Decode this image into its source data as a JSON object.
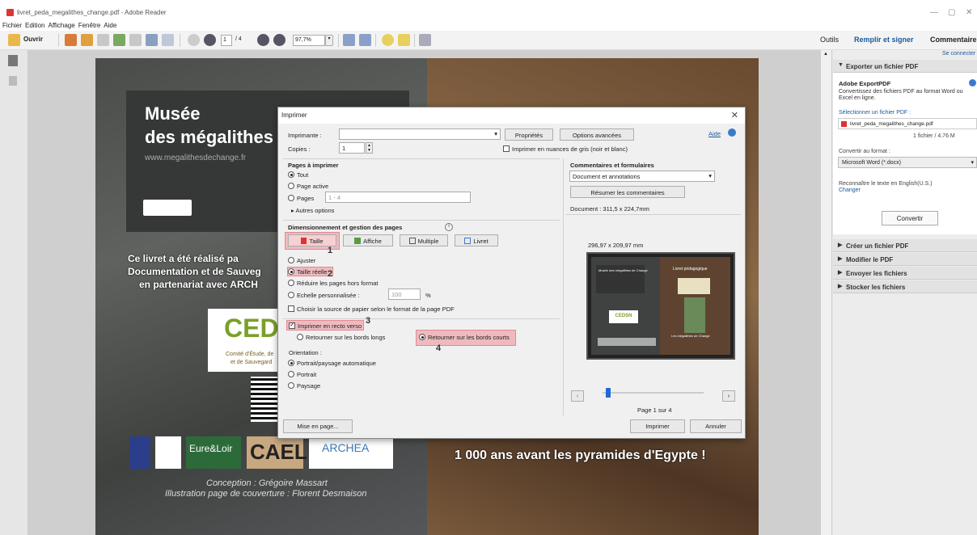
{
  "window": {
    "title": "livret_peda_megalithes_change.pdf - Adobe Reader"
  },
  "menu": [
    "Fichier",
    "Edition",
    "Affichage",
    "Fenêtre",
    "Aide"
  ],
  "toolbar": {
    "open_label": "Ouvrir",
    "page_current": "1",
    "page_total": "/ 4",
    "zoom": "97,7%"
  },
  "tabs": {
    "outils": "Outils",
    "remplir": "Remplir et signer",
    "commentaire": "Commentaire"
  },
  "pdf": {
    "title1": "Musée",
    "title2": "des mégalithes",
    "url": "www.megalithesdechange.fr",
    "line1": "Ce livret a été réalisé pa",
    "line2": "Documentation et de Sauveg",
    "line3": "en partenariat avec ARCH",
    "cedsn": "CED",
    "cedsn_sub1": "Comité d'Étude, de",
    "cedsn_sub2": "et de Sauvegard",
    "logo_eure": "Eure&Loir",
    "logo_cael": "CAEL",
    "logo_archea": "ARCHEA",
    "conception": "Conception : Grégoire Massart",
    "illustration": "Illustration page de couverture : Florent Desmaison",
    "right_line": "1 000 ans avant les pyramides d'Egypte !"
  },
  "dialog": {
    "title": "Imprimer",
    "printer_label": "Imprimante :",
    "properties": "Propriétés",
    "advanced": "Options avancées",
    "help": "Aide",
    "copies_label": "Copies :",
    "copies_value": "1",
    "grayscale": "Imprimer en nuances de gris (noir et blanc)",
    "pages_header": "Pages à imprimer",
    "all": "Tout",
    "current": "Page active",
    "pages": "Pages",
    "pages_value": "1 - 4",
    "more": "Autres options",
    "sizing_header": "Dimensionnement et gestion des pages",
    "btn_taille": "Taille",
    "btn_affiche": "Affiche",
    "btn_multiple": "Multiple",
    "btn_livret": "Livret",
    "fit": "Ajuster",
    "actual": "Taille réelle",
    "shrink": "Réduire les pages hors format",
    "custom": "Echelle personnalisée :",
    "custom_value": "100",
    "pct": "%",
    "paper_source": "Choisir la source de papier selon le format de la page PDF",
    "duplex": "Imprimer en recto verso",
    "flip_long": "Retourner sur les bords longs",
    "flip_short": "Retourner sur les bords courts",
    "orientation": "Orientation :",
    "auto": "Portrait/paysage automatique",
    "portrait": "Portrait",
    "landscape": "Paysage",
    "comments_header": "Commentaires et formulaires",
    "comments_value": "Document et annotations",
    "summarize": "Résumer les commentaires",
    "doc_size": "Document : 311,5 x 224,7mm",
    "preview_size": "296,97 x 209,97 mm",
    "page_of": "Page 1 sur 4",
    "setup": "Mise en page...",
    "print": "Imprimer",
    "cancel": "Annuler",
    "marks": [
      "1",
      "2",
      "3",
      "4"
    ]
  },
  "preview": {
    "left_title": "Musée des mégalithes de Change",
    "right_title": "Livret pédagogique",
    "cedsn": "CEDSN",
    "right_caption": "Les mégalithes de Change"
  },
  "panel": {
    "connect": "Se connecter",
    "export_header": "Exporter un fichier PDF",
    "export_title": "Adobe ExportPDF",
    "export_desc": "Convertissez des fichiers PDF au format Word ou Excel en ligne.",
    "select_label": "Sélectionner un fichier PDF :",
    "file_name": "livret_peda_megalithes_change.pdf",
    "file_info": "1 fichier / 4.76 M",
    "convert_to": "Convertir au format :",
    "format": "Microsoft Word (*.docx)",
    "recognize": "Reconnaître le texte en English(U.S.)",
    "change": "Changer",
    "convert": "Convertir",
    "create": "Créer un fichier PDF",
    "modify": "Modifier le PDF",
    "send": "Envoyer les fichiers",
    "store": "Stocker les fichiers"
  }
}
